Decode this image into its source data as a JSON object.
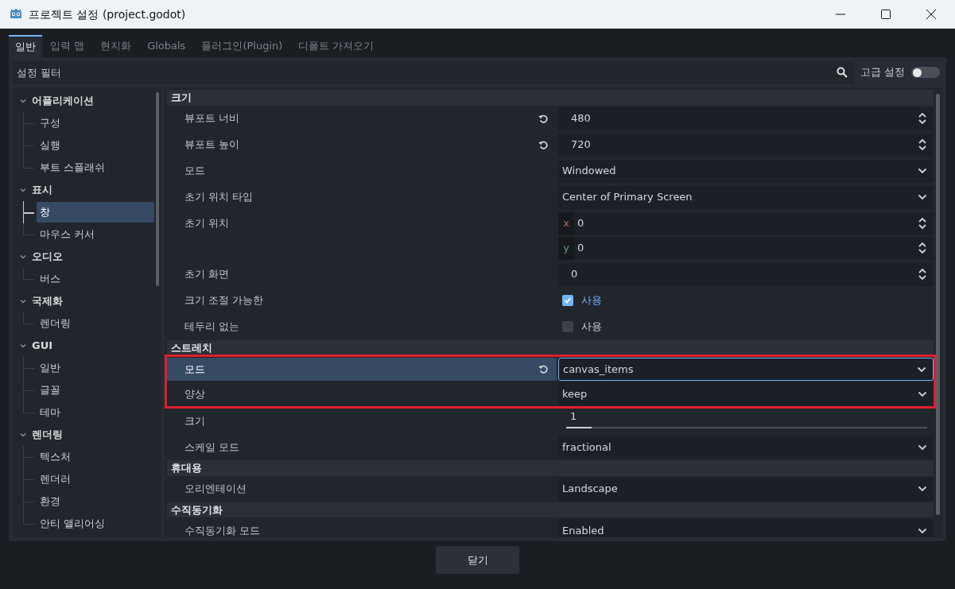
{
  "window": {
    "title": "프로젝트 설정 (project.godot)"
  },
  "tabs": [
    {
      "label": "일반",
      "selected": true
    },
    {
      "label": "입력 맵",
      "selected": false
    },
    {
      "label": "현지화",
      "selected": false
    },
    {
      "label": "Globals",
      "selected": false
    },
    {
      "label": "플러그인(Plugin)",
      "selected": false
    },
    {
      "label": "디폴트 가져오기",
      "selected": false
    }
  ],
  "filter": {
    "placeholder": "설정 필터"
  },
  "advanced": {
    "label": "고급 설정",
    "on": false
  },
  "sidebar": {
    "items": [
      {
        "label": "어플리케이션",
        "expanded": true,
        "children": [
          {
            "label": "구성",
            "selected": false
          },
          {
            "label": "실행",
            "selected": false
          },
          {
            "label": "부트 스플래쉬",
            "selected": false
          }
        ]
      },
      {
        "label": "표시",
        "expanded": true,
        "children": [
          {
            "label": "창",
            "selected": true
          },
          {
            "label": "마우스 커서",
            "selected": false
          }
        ]
      },
      {
        "label": "오디오",
        "expanded": true,
        "children": [
          {
            "label": "버스",
            "selected": false
          }
        ]
      },
      {
        "label": "국제화",
        "expanded": true,
        "children": [
          {
            "label": "렌더링",
            "selected": false
          }
        ]
      },
      {
        "label": "GUI",
        "expanded": true,
        "children": [
          {
            "label": "일반",
            "selected": false
          },
          {
            "label": "글꼴",
            "selected": false
          },
          {
            "label": "테마",
            "selected": false
          }
        ]
      },
      {
        "label": "렌더링",
        "expanded": true,
        "children": [
          {
            "label": "텍스처",
            "selected": false
          },
          {
            "label": "렌더러",
            "selected": false
          },
          {
            "label": "환경",
            "selected": false
          },
          {
            "label": "안티 앨리어싱",
            "selected": false
          }
        ]
      }
    ]
  },
  "sections": [
    {
      "title": "크기",
      "properties": [
        {
          "label": "뷰포트 너비",
          "kind": "spin",
          "value": "480",
          "revert": true,
          "selected": false,
          "highlighted": false
        },
        {
          "label": "뷰포트 높이",
          "kind": "spin",
          "value": "720",
          "revert": true,
          "selected": false,
          "highlighted": false
        },
        {
          "label": "모드",
          "kind": "dropdown",
          "value": "Windowed",
          "revert": false,
          "selected": false,
          "highlighted": false
        },
        {
          "label": "초기 위치 타입",
          "kind": "dropdown",
          "value": "Center of Primary Screen",
          "revert": false,
          "selected": false,
          "highlighted": false
        },
        {
          "label": "초기 위치",
          "kind": "vector",
          "components": [
            {
              "axis": "x",
              "value": "0",
              "color": "#a8695c"
            },
            {
              "axis": "y",
              "value": "0",
              "color": "#5e9a68"
            }
          ],
          "revert": false,
          "selected": false,
          "highlighted": false
        },
        {
          "label": "초기 화면",
          "kind": "spin",
          "value": "0",
          "revert": false,
          "selected": false,
          "highlighted": false
        },
        {
          "label": "크기 조절 가능한",
          "kind": "checkbox",
          "value": "사용",
          "checked": true,
          "revert": false,
          "selected": false,
          "highlighted": false
        },
        {
          "label": "테두리 없는",
          "kind": "checkbox",
          "value": "사용",
          "checked": false,
          "revert": false,
          "selected": false,
          "highlighted": false
        }
      ]
    },
    {
      "title": "스트레치",
      "properties": [
        {
          "label": "모드",
          "kind": "dropdown",
          "value": "canvas_items",
          "revert": true,
          "selected": true,
          "highlighted": true
        },
        {
          "label": "양상",
          "kind": "dropdown",
          "value": "keep",
          "revert": false,
          "selected": false,
          "highlighted": true
        },
        {
          "label": "크기",
          "kind": "slider",
          "value": "1",
          "level": 0.07,
          "revert": false,
          "selected": false,
          "highlighted": false
        },
        {
          "label": "스케일 모드",
          "kind": "dropdown",
          "value": "fractional",
          "revert": false,
          "selected": false,
          "highlighted": false
        }
      ]
    },
    {
      "title": "휴대용",
      "properties": [
        {
          "label": "오리엔테이션",
          "kind": "dropdown",
          "value": "Landscape",
          "revert": false,
          "selected": false,
          "highlighted": false
        }
      ]
    },
    {
      "title": "수직동기화",
      "properties": [
        {
          "label": "수직동기화 모드",
          "kind": "dropdown",
          "value": "Enabled",
          "revert": false,
          "selected": false,
          "highlighted": false
        }
      ]
    }
  ],
  "footer": {
    "button": "닫기"
  }
}
